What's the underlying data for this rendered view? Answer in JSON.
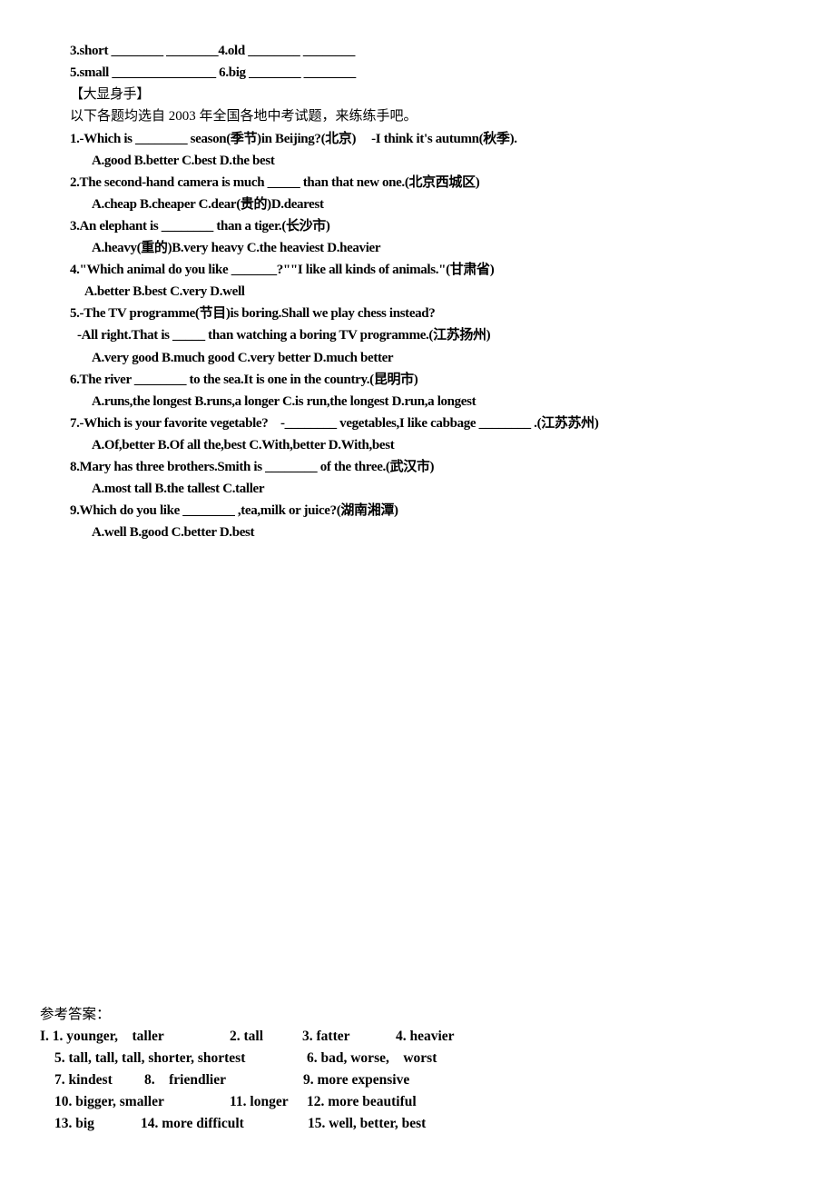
{
  "exercise_tail": [
    "3.short ________ ________4.old ________ ________",
    "5.small ________________ 6.big ________ ________"
  ],
  "section_title": "【大显身手】",
  "section_intro": "以下各题均选自 2003 年全国各地中考试题，来练练手吧。",
  "questions": [
    {
      "q": "1.-Which is ________ season(季节)in Beijing?(北京)     -I think it's autumn(秋季).",
      "options": "A.good B.better C.best D.the best"
    },
    {
      "q": "2.The second-hand camera is much _____ than that new one.(北京西城区)",
      "options": "A.cheap B.cheaper C.dear(贵的)D.dearest"
    },
    {
      "q": "3.An elephant is ________ than a tiger.(长沙市)",
      "options": "A.heavy(重的)B.very heavy C.the heaviest D.heavier"
    },
    {
      "q": "4.\"Which animal do you like _______?\"\"I like all kinds of animals.\"(甘肃省)",
      "options": "A.better B.best C.very D.well"
    },
    {
      "q": "5.-The TV programme(节目)is boring.Shall we play chess instead?",
      "q2": "-All right.That is _____ than watching a boring TV programme.(江苏扬州)",
      "options": "A.very good B.much good C.very better D.much better"
    },
    {
      "q": "6.The river ________ to the sea.It is one in the country.(昆明市)",
      "options": "A.runs,the longest B.runs,a longer C.is run,the longest D.run,a longest"
    },
    {
      "q": "7.-Which is your favorite vegetable?    -________ vegetables,I like cabbage ________ .(江苏苏州)",
      "options": "A.Of,better B.Of all the,best C.With,better D.With,best"
    },
    {
      "q": "8.Mary has three brothers.Smith is ________ of the three.(武汉市)",
      "options": "A.most tall B.the tallest C.taller"
    },
    {
      "q": "9.Which do you like ________ ,tea,milk or juice?(湖南湘潭)",
      "options": "A.well B.good C.better D.best"
    }
  ],
  "answers": {
    "title": "参考答案：",
    "rows": [
      [
        "I. 1. younger,    taller",
        "2. tall",
        "3. fatter",
        "4. heavier"
      ],
      [
        "5. tall, tall, tall, shorter, shortest",
        "6. bad, worse,    worst"
      ],
      [
        "7. kindest",
        "8.    friendlier",
        "9. more expensive"
      ],
      [
        "10. bigger, smaller",
        "11. longer",
        "12. more beautiful"
      ],
      [
        "13. big",
        "14. more difficult",
        "15. well, better, best"
      ]
    ]
  }
}
